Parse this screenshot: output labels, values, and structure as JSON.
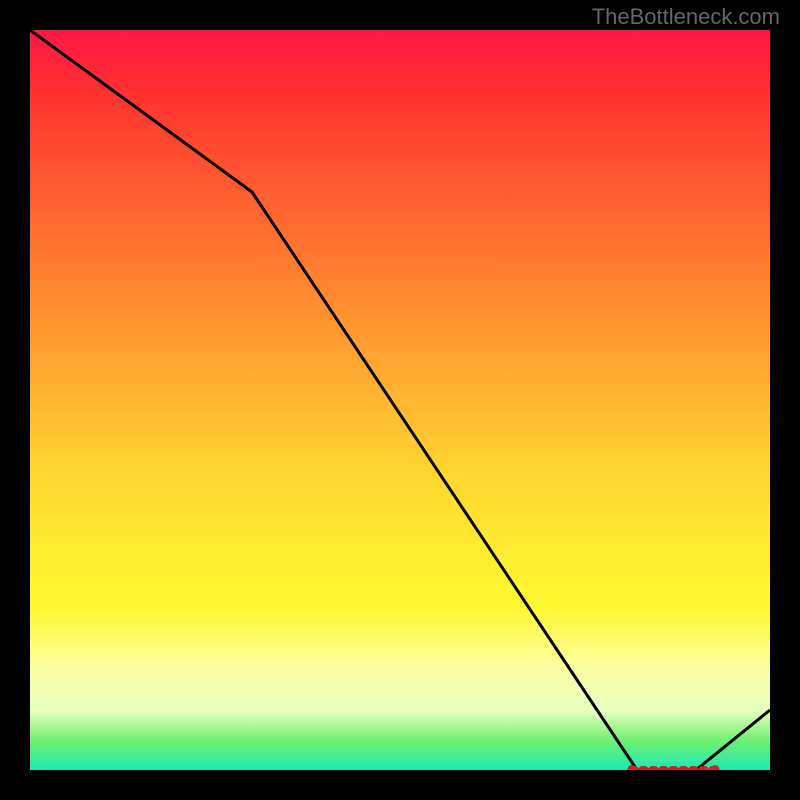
{
  "watermark": "TheBottleneck.com",
  "chart_data": {
    "type": "line",
    "title": "",
    "xlabel": "",
    "ylabel": "",
    "x": [
      0.0,
      0.3,
      0.82,
      0.9,
      1.0
    ],
    "values": [
      1.0,
      0.78,
      0.0,
      0.0,
      0.08
    ],
    "marker_segment": {
      "x_start": 0.82,
      "x_end": 0.92,
      "y": 0.0
    },
    "note": "gradient background red (top) -> yellow -> green (bottom). Line descends from top-left, kinks near x~0.30, drops to baseline ~x~0.82, flat with red dashed marker segment, then rises slightly to right edge. No visible axis ticks or numeric labels."
  }
}
